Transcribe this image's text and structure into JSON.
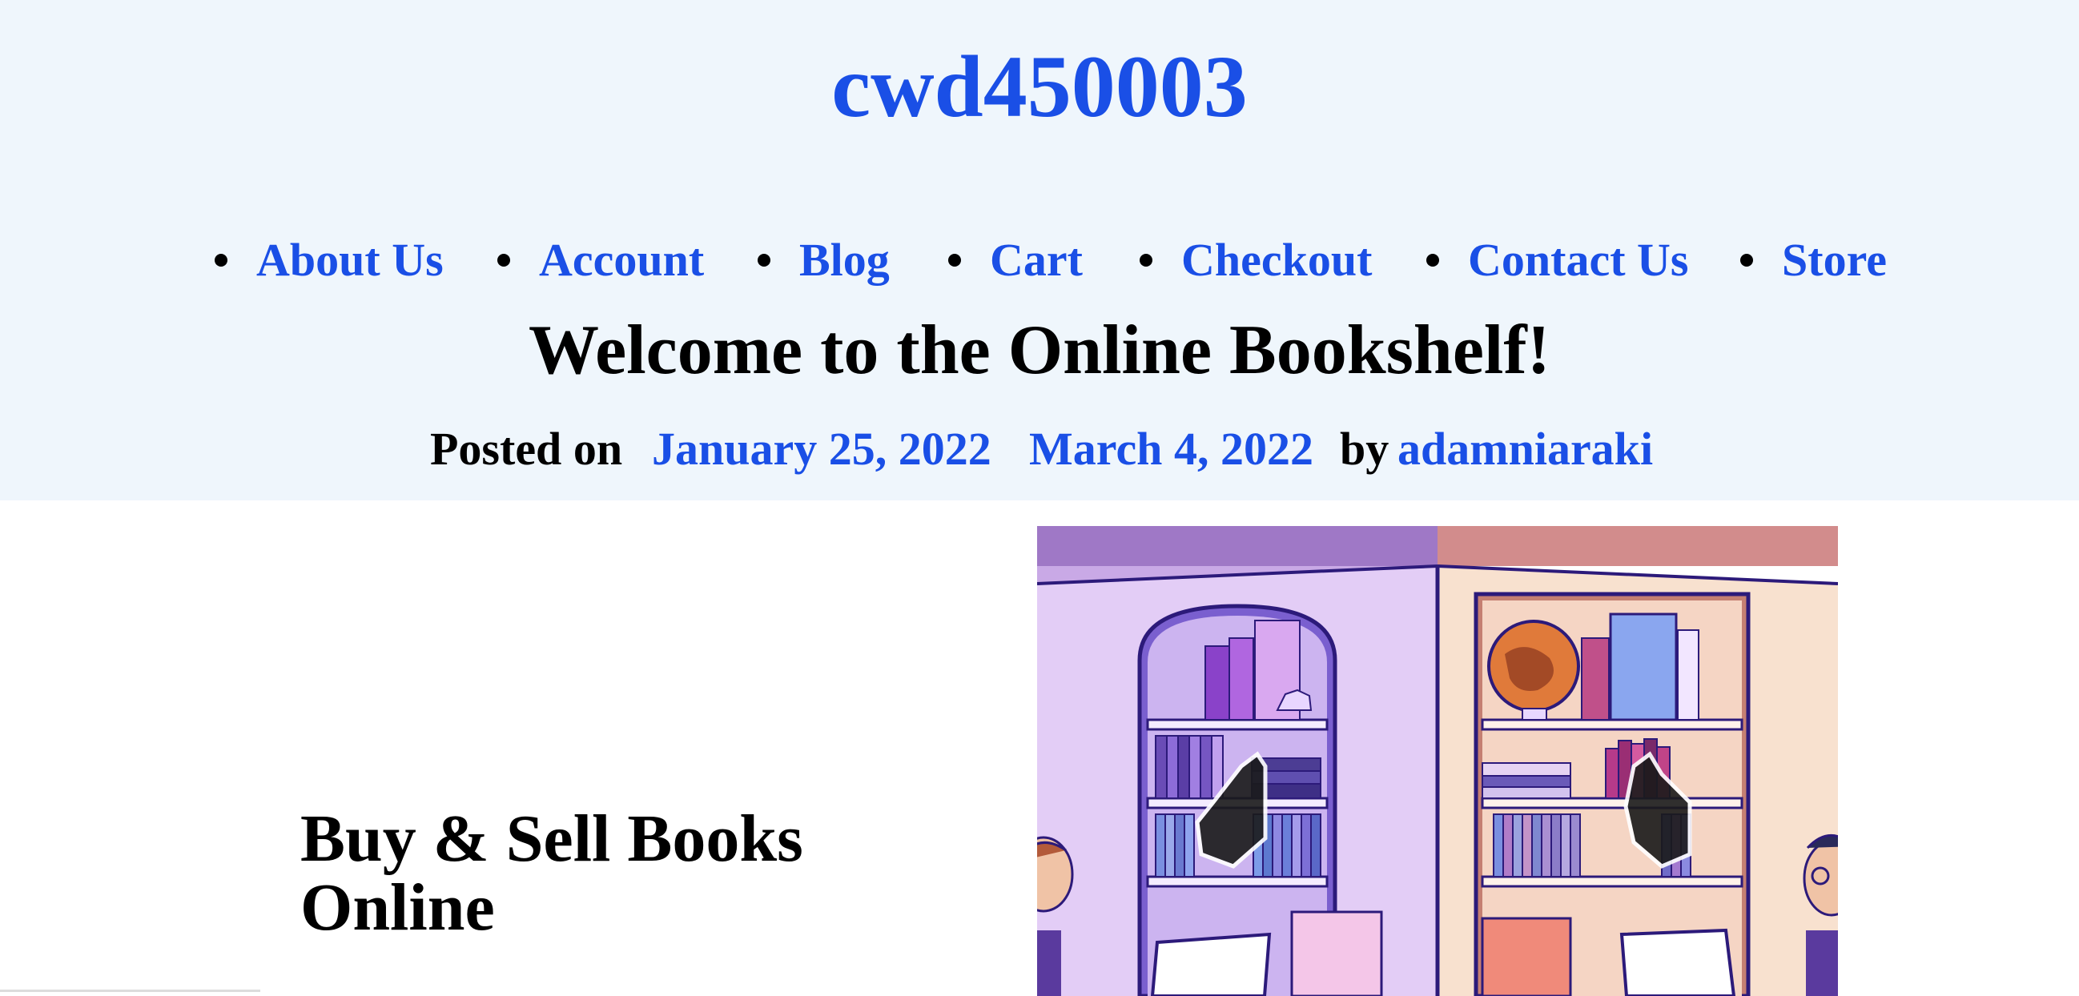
{
  "site": {
    "title": "cwd450003"
  },
  "nav": {
    "items": [
      {
        "label": "About Us"
      },
      {
        "label": "Account"
      },
      {
        "label": "Blog"
      },
      {
        "label": "Cart"
      },
      {
        "label": "Checkout"
      },
      {
        "label": "Contact Us"
      },
      {
        "label": "Store"
      }
    ]
  },
  "post": {
    "title": "Welcome to the Online Bookshelf!",
    "posted_on_label": "Posted on",
    "published_date": "January 25, 2022",
    "updated_date": "March 4, 2022",
    "by_label": "by",
    "author": "adamniaraki"
  },
  "hero": {
    "heading_line1": "Buy & Sell Books",
    "heading_line2": "Online",
    "image_icon": "bookshelf-illustration"
  },
  "colors": {
    "link": "#1a4fe6",
    "header_bg": "#eff6fc",
    "text": "#000000"
  }
}
